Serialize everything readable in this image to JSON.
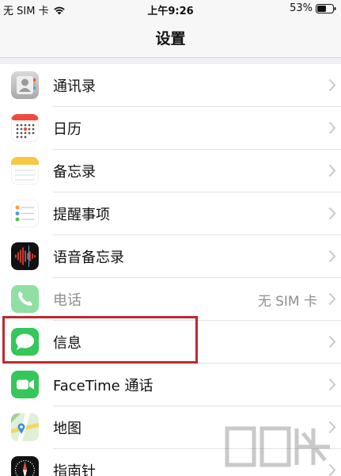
{
  "status_bar": {
    "carrier": "无 SIM 卡",
    "time": "上午9:26",
    "battery": "53%"
  },
  "nav": {
    "title": "设置"
  },
  "items": [
    {
      "label": "通讯录",
      "icon": "contacts-icon",
      "value": ""
    },
    {
      "label": "日历",
      "icon": "calendar-icon",
      "value": ""
    },
    {
      "label": "备忘录",
      "icon": "notes-icon",
      "value": ""
    },
    {
      "label": "提醒事项",
      "icon": "reminders-icon",
      "value": ""
    },
    {
      "label": "语音备忘录",
      "icon": "voice-memos-icon",
      "value": ""
    },
    {
      "label": "电话",
      "icon": "phone-icon",
      "value": "无 SIM 卡"
    },
    {
      "label": "信息",
      "icon": "messages-icon",
      "value": ""
    },
    {
      "label": "FaceTime 通话",
      "icon": "facetime-icon",
      "value": ""
    },
    {
      "label": "地图",
      "icon": "maps-icon",
      "value": ""
    },
    {
      "label": "指南针",
      "icon": "compass-icon",
      "value": ""
    }
  ],
  "colors": {
    "highlight": "#c0282e",
    "messages_green": "#34c759",
    "facetime_green": "#34c759",
    "secondary_text": "#8e8e93"
  }
}
